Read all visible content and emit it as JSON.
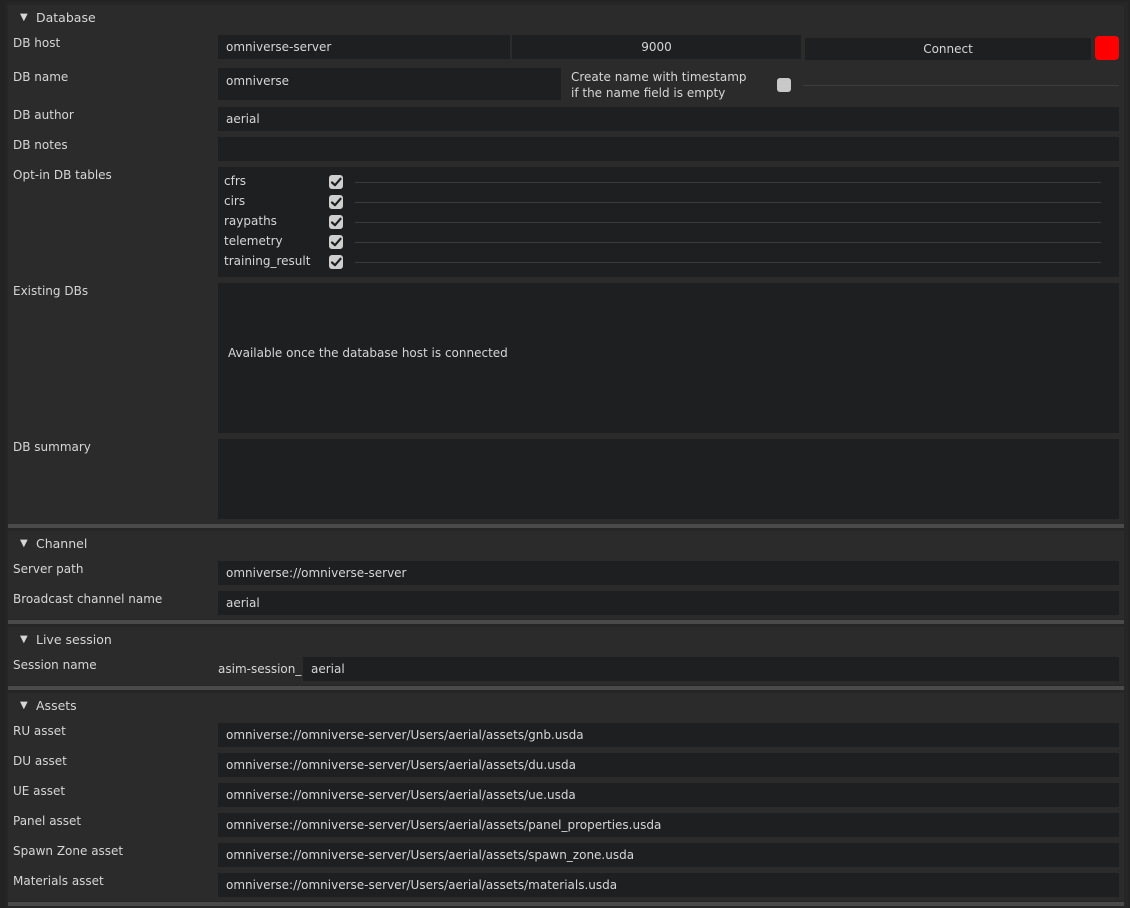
{
  "database": {
    "title": "Database",
    "host_label": "DB host",
    "host_value": "omniverse-server",
    "port_value": "9000",
    "connect_label": "Connect",
    "status_color": "#ff0000",
    "name_label": "DB name",
    "name_value": "omniverse",
    "timestamp_note_line1": "Create name with timestamp",
    "timestamp_note_line2": "if the name field is empty",
    "timestamp_checked": false,
    "author_label": "DB author",
    "author_value": "aerial",
    "notes_label": "DB notes",
    "notes_value": "",
    "optin_label": "Opt-in DB tables",
    "tables": [
      {
        "name": "cfrs",
        "checked": true
      },
      {
        "name": "cirs",
        "checked": true
      },
      {
        "name": "raypaths",
        "checked": true
      },
      {
        "name": "telemetry",
        "checked": true
      },
      {
        "name": "training_result",
        "checked": true
      }
    ],
    "existing_label": "Existing DBs",
    "existing_placeholder": "Available once the database host is connected",
    "summary_label": "DB summary",
    "summary_value": ""
  },
  "channel": {
    "title": "Channel",
    "server_path_label": "Server path",
    "server_path_value": "omniverse://omniverse-server",
    "broadcast_label": "Broadcast channel name",
    "broadcast_value": "aerial"
  },
  "live_session": {
    "title": "Live session",
    "session_label": "Session name",
    "session_prefix": "asim-session_",
    "session_value": "aerial"
  },
  "assets": {
    "title": "Assets",
    "items": [
      {
        "label": "RU asset",
        "value": "omniverse://omniverse-server/Users/aerial/assets/gnb.usda"
      },
      {
        "label": "DU asset",
        "value": "omniverse://omniverse-server/Users/aerial/assets/du.usda"
      },
      {
        "label": "UE asset",
        "value": "omniverse://omniverse-server/Users/aerial/assets/ue.usda"
      },
      {
        "label": "Panel asset",
        "value": "omniverse://omniverse-server/Users/aerial/assets/panel_properties.usda"
      },
      {
        "label": "Spawn Zone asset",
        "value": "omniverse://omniverse-server/Users/aerial/assets/spawn_zone.usda"
      },
      {
        "label": "Materials asset",
        "value": "omniverse://omniverse-server/Users/aerial/assets/materials.usda"
      }
    ]
  },
  "icons": {
    "collapse": "triangle-down-icon",
    "check": "checkmark-icon"
  }
}
